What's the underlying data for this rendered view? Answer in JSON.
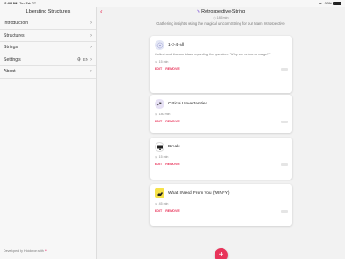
{
  "status": {
    "time": "11:08 PM",
    "date": "Thu Feb 27",
    "battery": "100%"
  },
  "sidebar": {
    "title": "Liberating Structures",
    "items": [
      {
        "label": "Introduction"
      },
      {
        "label": "Structures"
      },
      {
        "label": "Strings"
      },
      {
        "label": "Settings",
        "lang": "EN"
      },
      {
        "label": "About"
      }
    ],
    "footer": "Developed by Holokron with"
  },
  "main": {
    "title": "Retrospective-String",
    "total_time": "185 min",
    "description": "Gathering insights using the magical unicorn String for our team retrospective",
    "edit_label": "EDIT",
    "remove_label": "REMOVE",
    "cards": [
      {
        "title": "1-2-4-All",
        "body": "Collect and discuss ideas regarding the question: \"Why are unicorns magic?\"",
        "time": "15 min",
        "icon": "dots-circle-icon",
        "icon_bg": "#e3e6f5"
      },
      {
        "title": "Critical Uncertainties",
        "body": "",
        "time": "180 min",
        "icon": "arrow-icon",
        "icon_bg": "#e7e1f5"
      },
      {
        "title": "Break",
        "body": "",
        "time": "15 min",
        "icon": "monitor-icon",
        "icon_bg": "#ffffff"
      },
      {
        "title": "What I Need From You (WINFY)",
        "body": "",
        "time": "45 min",
        "icon": "hands-icon",
        "icon_bg": "#f6e24a"
      }
    ]
  },
  "colors": {
    "accent": "#e8345a",
    "brand_purple": "#6c3bd1"
  }
}
